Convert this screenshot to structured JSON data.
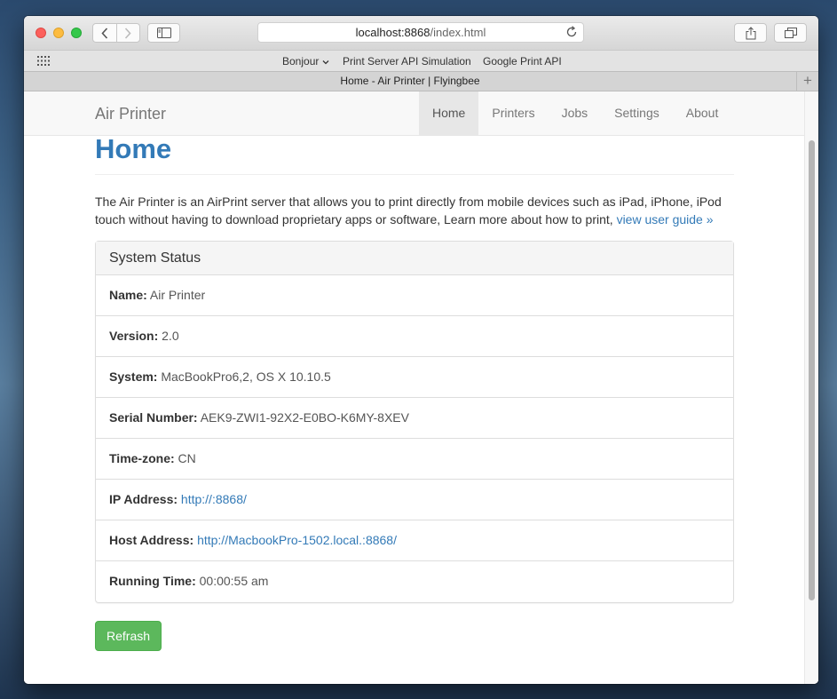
{
  "browser": {
    "url_host": "localhost:8868",
    "url_path": "/index.html",
    "favorites": [
      "Bonjour",
      "Print Server API Simulation",
      "Google Print API"
    ],
    "tab_title": "Home - Air Printer | Flyingbee",
    "new_tab_label": "+"
  },
  "navbar": {
    "brand": "Air Printer",
    "links": [
      "Home",
      "Printers",
      "Jobs",
      "Settings",
      "About"
    ],
    "active": "Home"
  },
  "page": {
    "title": "Home",
    "intro": "The Air Printer is an AirPrint server that allows you to print directly from mobile devices such as iPad, iPhone, iPod touch without having to download proprietary apps or software, Learn more about how to print, ",
    "intro_link": "view user guide »"
  },
  "status": {
    "heading": "System Status",
    "rows": [
      {
        "label": "Name:",
        "value": "Air Printer"
      },
      {
        "label": "Version:",
        "value": "2.0"
      },
      {
        "label": "System:",
        "value": "MacBookPro6,2, OS X 10.10.5"
      },
      {
        "label": "Serial Number:",
        "value": "AEK9-ZWI1-92X2-E0BO-K6MY-8XEV"
      },
      {
        "label": "Time-zone:",
        "value": "CN"
      },
      {
        "label": "IP Address:",
        "value": "http://:8868/"
      },
      {
        "label": "Host Address:",
        "value": "http://MacbookPro-1502.local.:8868/"
      },
      {
        "label": "Running Time:",
        "value": "00:00:55 am"
      }
    ]
  },
  "refresh_label": "Refrash",
  "colors": {
    "link": "#337ab7",
    "success": "#5cb85c"
  }
}
